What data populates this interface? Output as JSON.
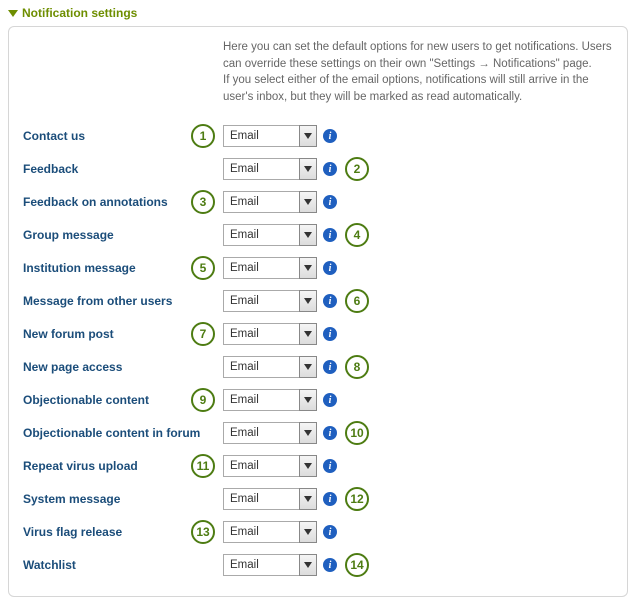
{
  "header": {
    "title": "Notification settings"
  },
  "intro": {
    "line1": "Here you can set the default options for new users to get notifications. Users can override these settings on their own \"Settings → Notifications\" page.",
    "line2": "If you select either of the email options, notifications will still arrive in the user's inbox, but they will be marked as read automatically."
  },
  "select_value": "Email",
  "info_glyph": "i",
  "rows": [
    {
      "label": "Contact us",
      "badge": "1",
      "side": "left"
    },
    {
      "label": "Feedback",
      "badge": "2",
      "side": "right"
    },
    {
      "label": "Feedback on annotations",
      "badge": "3",
      "side": "left"
    },
    {
      "label": "Group message",
      "badge": "4",
      "side": "right"
    },
    {
      "label": "Institution message",
      "badge": "5",
      "side": "left"
    },
    {
      "label": "Message from other users",
      "badge": "6",
      "side": "right"
    },
    {
      "label": "New forum post",
      "badge": "7",
      "side": "left"
    },
    {
      "label": "New page access",
      "badge": "8",
      "side": "right"
    },
    {
      "label": "Objectionable content",
      "badge": "9",
      "side": "left"
    },
    {
      "label": "Objectionable content in forum",
      "badge": "10",
      "side": "right"
    },
    {
      "label": "Repeat virus upload",
      "badge": "11",
      "side": "left"
    },
    {
      "label": "System message",
      "badge": "12",
      "side": "right"
    },
    {
      "label": "Virus flag release",
      "badge": "13",
      "side": "left"
    },
    {
      "label": "Watchlist",
      "badge": "14",
      "side": "right"
    }
  ]
}
